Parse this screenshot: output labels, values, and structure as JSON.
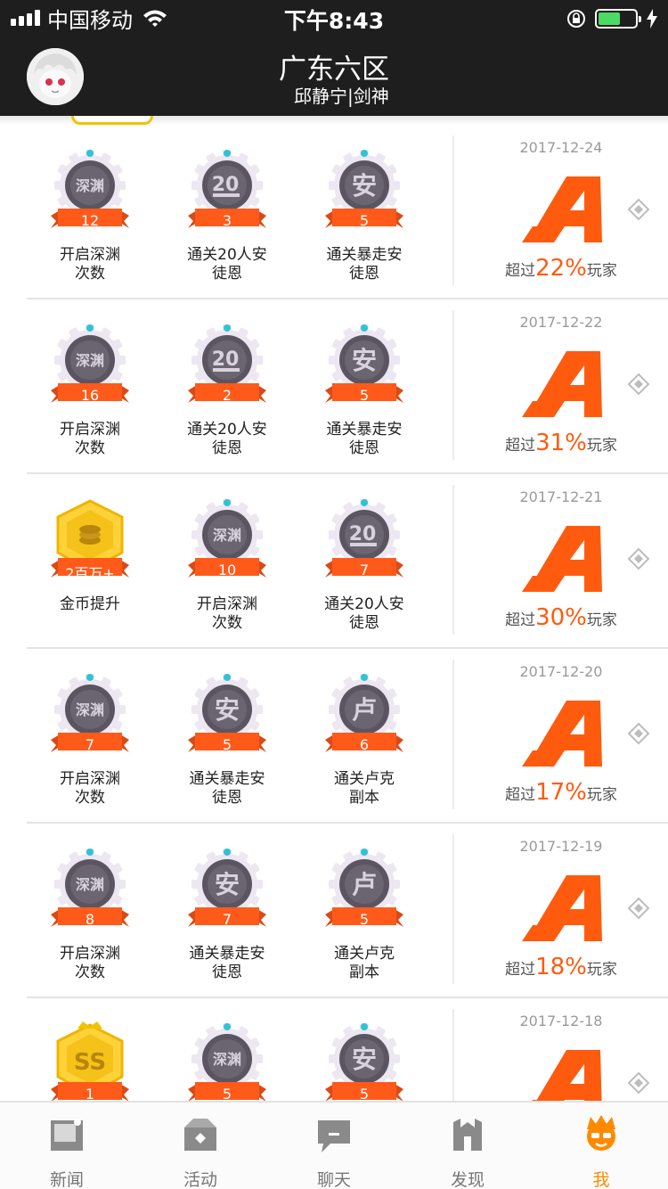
{
  "status_bar": {
    "carrier": "中国移动",
    "time": "下午8:43",
    "battery_level": 0.6
  },
  "header": {
    "title": "广东六区",
    "subtitle": "邱静宁|剑神"
  },
  "badge_icons": {
    "abyss": "深渊",
    "team20": "20",
    "anton": "安",
    "luke": "卢"
  },
  "rows": [
    {
      "date": "2017-12-24",
      "grade_icon": "grade-a-icon",
      "rank_prefix": "超过",
      "rank_pct": "22%",
      "rank_suffix": "玩家",
      "badges": [
        {
          "icon": "abyss",
          "count": "12",
          "label_line1": "开启深渊",
          "label_line2": "次数"
        },
        {
          "icon": "team20",
          "count": "3",
          "label_line1": "通关20人安",
          "label_line2": "徒恩"
        },
        {
          "icon": "anton",
          "count": "5",
          "label_line1": "通关暴走安",
          "label_line2": "徒恩"
        }
      ]
    },
    {
      "date": "2017-12-22",
      "grade_icon": "grade-a-icon",
      "rank_prefix": "超过",
      "rank_pct": "31%",
      "rank_suffix": "玩家",
      "badges": [
        {
          "icon": "abyss",
          "count": "16",
          "label_line1": "开启深渊",
          "label_line2": "次数"
        },
        {
          "icon": "team20",
          "count": "2",
          "label_line1": "通关20人安",
          "label_line2": "徒恩"
        },
        {
          "icon": "anton",
          "count": "5",
          "label_line1": "通关暴走安",
          "label_line2": "徒恩"
        }
      ]
    },
    {
      "date": "2017-12-21",
      "grade_icon": "grade-a-icon",
      "rank_prefix": "超过",
      "rank_pct": "30%",
      "rank_suffix": "玩家",
      "badges": [
        {
          "icon": "gold",
          "count": "2百万+",
          "label_line1": "金币提升",
          "label_line2": ""
        },
        {
          "icon": "abyss",
          "count": "10",
          "label_line1": "开启深渊",
          "label_line2": "次数"
        },
        {
          "icon": "team20",
          "count": "7",
          "label_line1": "通关20人安",
          "label_line2": "徒恩"
        }
      ]
    },
    {
      "date": "2017-12-20",
      "grade_icon": "grade-a-icon",
      "rank_prefix": "超过",
      "rank_pct": "17%",
      "rank_suffix": "玩家",
      "badges": [
        {
          "icon": "abyss",
          "count": "7",
          "label_line1": "开启深渊",
          "label_line2": "次数"
        },
        {
          "icon": "anton",
          "count": "5",
          "label_line1": "通关暴走安",
          "label_line2": "徒恩"
        },
        {
          "icon": "luke",
          "count": "6",
          "label_line1": "通关卢克",
          "label_line2": "副本"
        }
      ]
    },
    {
      "date": "2017-12-19",
      "grade_icon": "grade-a-icon",
      "rank_prefix": "超过",
      "rank_pct": "18%",
      "rank_suffix": "玩家",
      "badges": [
        {
          "icon": "abyss",
          "count": "8",
          "label_line1": "开启深渊",
          "label_line2": "次数"
        },
        {
          "icon": "anton",
          "count": "7",
          "label_line1": "通关暴走安",
          "label_line2": "徒恩"
        },
        {
          "icon": "luke",
          "count": "5",
          "label_line1": "通关卢克",
          "label_line2": "副本"
        }
      ]
    },
    {
      "date": "2017-12-18",
      "grade_icon": "grade-a-icon",
      "rank_prefix": "",
      "rank_pct": "",
      "rank_suffix": "",
      "badges": [
        {
          "icon": "ss",
          "count": "1",
          "label_line1": "",
          "label_line2": ""
        },
        {
          "icon": "abyss",
          "count": "5",
          "label_line1": "",
          "label_line2": ""
        },
        {
          "icon": "anton",
          "count": "5",
          "label_line1": "",
          "label_line2": ""
        }
      ]
    }
  ],
  "tab_bar": {
    "tabs": [
      {
        "label": "新闻",
        "icon": "news-icon"
      },
      {
        "label": "活动",
        "icon": "activity-icon"
      },
      {
        "label": "聊天",
        "icon": "chat-icon"
      },
      {
        "label": "发现",
        "icon": "discover-icon"
      },
      {
        "label": "我",
        "icon": "me-icon"
      }
    ],
    "active_index": 4
  },
  "colors": {
    "header_bg": "#1e1e1e",
    "accent": "#ff5b0f",
    "ribbon": "#ff5a1a",
    "active_tab": "#ff8a00",
    "gold": "#f3c200"
  }
}
